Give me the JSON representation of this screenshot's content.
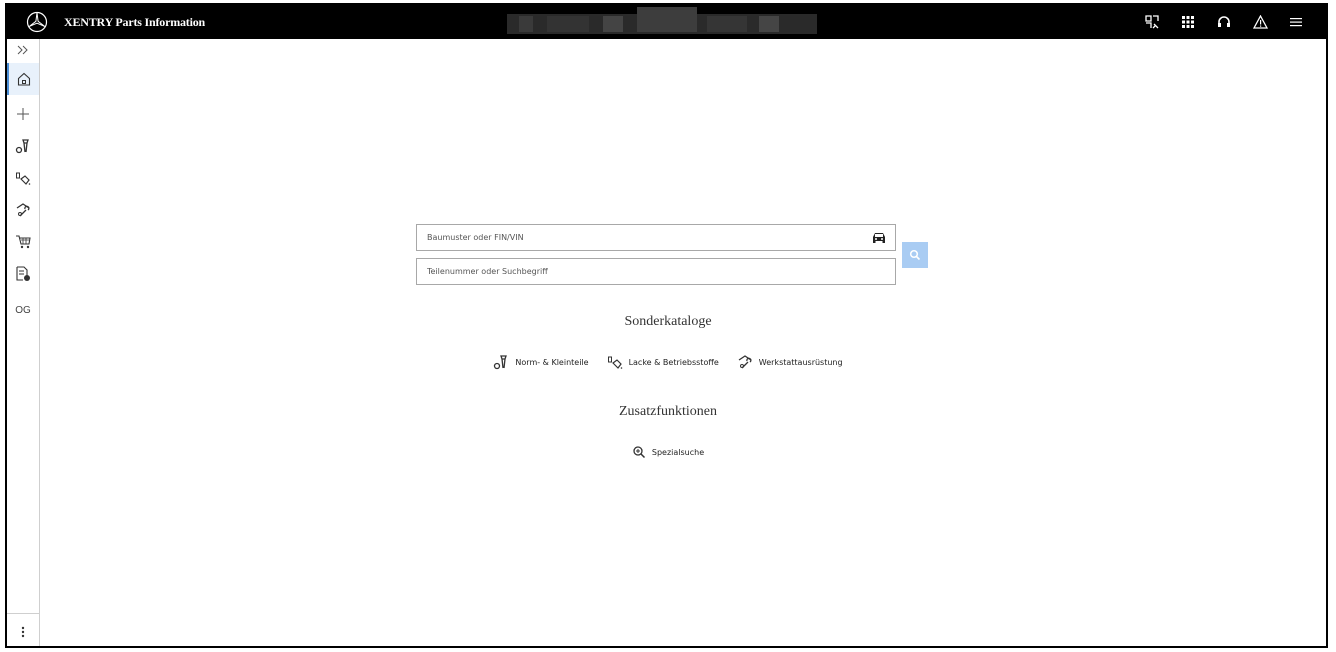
{
  "app": {
    "title": "XENTRY Parts Information"
  },
  "topbar": {
    "icons": [
      "scan-icon",
      "grid-icon",
      "headset-icon",
      "warning-icon",
      "menu-icon"
    ]
  },
  "sidebar": {
    "items": [
      {
        "name": "expand-icon"
      },
      {
        "name": "home-icon",
        "active": true
      },
      {
        "name": "plus-icon"
      },
      {
        "name": "parts-icon"
      },
      {
        "name": "paint-icon"
      },
      {
        "name": "workshop-icon"
      },
      {
        "name": "cart-icon"
      },
      {
        "name": "document-icon"
      },
      {
        "name": "og-item",
        "label": "OG"
      },
      {
        "name": "more-icon"
      }
    ]
  },
  "search": {
    "model_placeholder": "Baumuster oder FIN/VIN",
    "part_placeholder": "Teilenummer oder Suchbegriff"
  },
  "special_catalogs": {
    "title": "Sonderkataloge",
    "items": [
      {
        "label": "Norm- & Kleinteile"
      },
      {
        "label": "Lacke & Betriebsstoffe"
      },
      {
        "label": "Werkstattausrüstung"
      }
    ]
  },
  "additional_functions": {
    "title": "Zusatzfunktionen",
    "items": [
      {
        "label": "Spezialsuche"
      }
    ]
  },
  "colors": {
    "topbar": "#000000",
    "accent": "#4d90d8",
    "search_button": "#a9ccf3"
  }
}
